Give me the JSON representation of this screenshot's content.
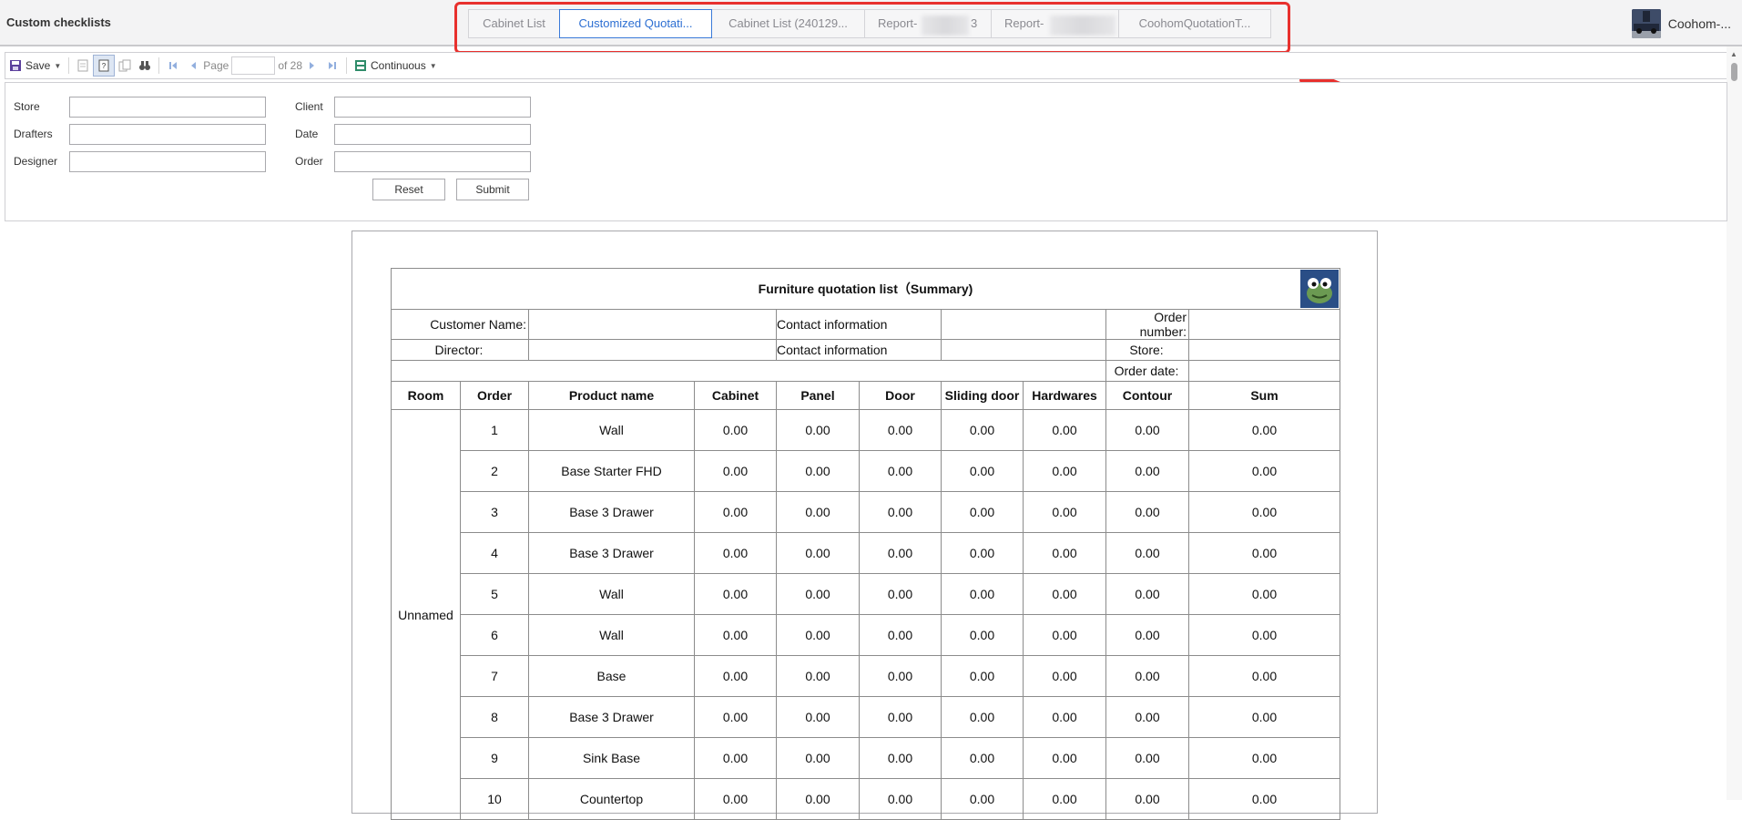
{
  "app": {
    "title": "Custom checklists"
  },
  "tabs": [
    {
      "label": "Cabinet List",
      "active": false
    },
    {
      "label": "Customized Quotati...",
      "active": true
    },
    {
      "label": "Cabinet List (240129...",
      "active": false
    },
    {
      "label": "Report-",
      "suffix": "3",
      "active": false
    },
    {
      "label": "Report-",
      "suffix": "",
      "active": false
    },
    {
      "label": "CoohomQuotationT...",
      "active": false
    }
  ],
  "user": {
    "name": "Coohom-..."
  },
  "toolbar": {
    "save_label": "Save",
    "page_label": "Page",
    "page_value": "",
    "page_total": "of 28",
    "view_mode": "Continuous"
  },
  "filters": {
    "store_label": "Store",
    "drafters_label": "Drafters",
    "designer_label": "Designer",
    "client_label": "Client",
    "date_label": "Date",
    "order_label": "Order",
    "store_value": "",
    "drafters_value": "",
    "designer_value": "",
    "client_value": "",
    "date_value": "",
    "order_value": "",
    "reset_label": "Reset",
    "submit_label": "Submit"
  },
  "report": {
    "title": "Furniture quotation list（Summary)",
    "customer_name_label": "Customer Name:",
    "director_label": "Director:",
    "contact_info_label": "Contact information",
    "order_number_label": "Order number:",
    "store_label": "Store:",
    "order_date_label": "Order date:",
    "columns": [
      "Room",
      "Order",
      "Product name",
      "Cabinet",
      "Panel",
      "Door",
      "Sliding door",
      "Hardwares",
      "Contour",
      "Sum"
    ],
    "room_name": "Unnamed",
    "rows": [
      {
        "order": "1",
        "product": "Wall",
        "cabinet": "0.00",
        "panel": "0.00",
        "door": "0.00",
        "sliding": "0.00",
        "hardwares": "0.00",
        "contour": "0.00",
        "sum": "0.00"
      },
      {
        "order": "2",
        "product": "Base Starter FHD",
        "cabinet": "0.00",
        "panel": "0.00",
        "door": "0.00",
        "sliding": "0.00",
        "hardwares": "0.00",
        "contour": "0.00",
        "sum": "0.00"
      },
      {
        "order": "3",
        "product": "Base 3 Drawer",
        "cabinet": "0.00",
        "panel": "0.00",
        "door": "0.00",
        "sliding": "0.00",
        "hardwares": "0.00",
        "contour": "0.00",
        "sum": "0.00"
      },
      {
        "order": "4",
        "product": "Base 3 Drawer",
        "cabinet": "0.00",
        "panel": "0.00",
        "door": "0.00",
        "sliding": "0.00",
        "hardwares": "0.00",
        "contour": "0.00",
        "sum": "0.00"
      },
      {
        "order": "5",
        "product": "Wall",
        "cabinet": "0.00",
        "panel": "0.00",
        "door": "0.00",
        "sliding": "0.00",
        "hardwares": "0.00",
        "contour": "0.00",
        "sum": "0.00"
      },
      {
        "order": "6",
        "product": "Wall",
        "cabinet": "0.00",
        "panel": "0.00",
        "door": "0.00",
        "sliding": "0.00",
        "hardwares": "0.00",
        "contour": "0.00",
        "sum": "0.00"
      },
      {
        "order": "7",
        "product": "Base",
        "cabinet": "0.00",
        "panel": "0.00",
        "door": "0.00",
        "sliding": "0.00",
        "hardwares": "0.00",
        "contour": "0.00",
        "sum": "0.00"
      },
      {
        "order": "8",
        "product": "Base 3 Drawer",
        "cabinet": "0.00",
        "panel": "0.00",
        "door": "0.00",
        "sliding": "0.00",
        "hardwares": "0.00",
        "contour": "0.00",
        "sum": "0.00"
      },
      {
        "order": "9",
        "product": "Sink Base",
        "cabinet": "0.00",
        "panel": "0.00",
        "door": "0.00",
        "sliding": "0.00",
        "hardwares": "0.00",
        "contour": "0.00",
        "sum": "0.00"
      },
      {
        "order": "10",
        "product": "Countertop",
        "cabinet": "0.00",
        "panel": "0.00",
        "door": "0.00",
        "sliding": "0.00",
        "hardwares": "0.00",
        "contour": "0.00",
        "sum": "0.00"
      }
    ]
  },
  "colors": {
    "accent": "#2d6fd2",
    "annotation": "#e8302d",
    "logo_bg": "#2a4e86"
  },
  "icons": [
    "save-icon",
    "print-icon",
    "single-page-icon",
    "multi-page-icon",
    "find-icon",
    "first-page-icon",
    "prev-page-icon",
    "next-page-icon",
    "last-page-icon",
    "continuous-icon",
    "avatar",
    "logo"
  ]
}
